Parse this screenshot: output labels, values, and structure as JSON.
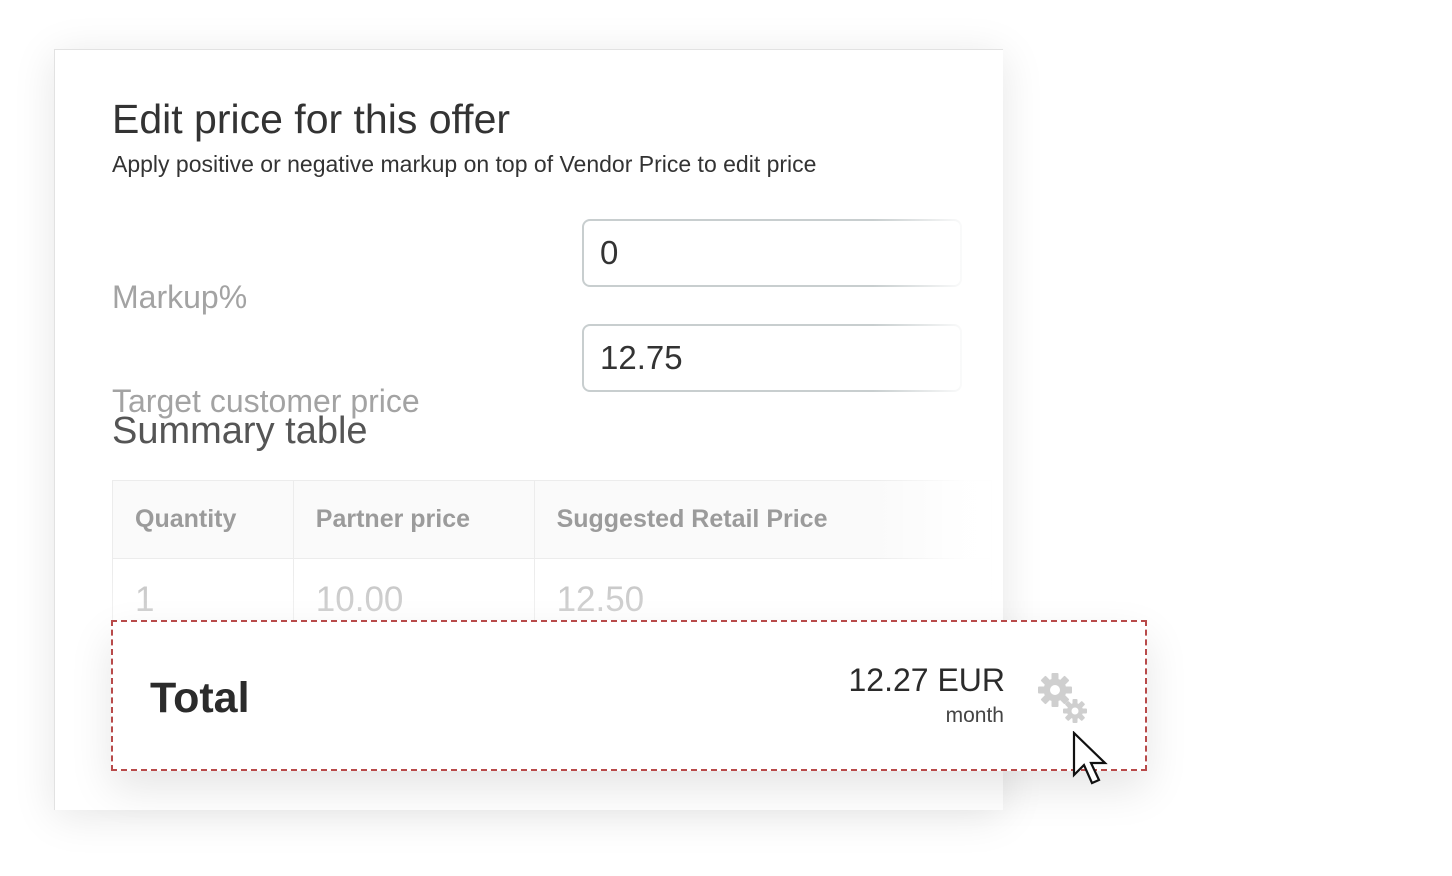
{
  "modal": {
    "title": "Edit price for this offer",
    "subtitle": "Apply positive or negative markup on top of Vendor Price to edit price"
  },
  "form": {
    "markup": {
      "label": "Markup%",
      "value": "0"
    },
    "target_price": {
      "label": "Target customer price",
      "value": "12.75"
    }
  },
  "summary": {
    "title": "Summary table",
    "columns": [
      "Quantity",
      "Partner price",
      "Suggested Retail Price"
    ],
    "rows": [
      [
        "1",
        "10.00",
        "12.50"
      ]
    ]
  },
  "total": {
    "label": "Total",
    "amount": "12.27 EUR",
    "period": "month"
  },
  "icons": {
    "settings": "gears-icon",
    "pointer": "mouse-cursor-icon"
  },
  "colors": {
    "dashed_border": "#b84a4a",
    "label_gray": "#a3a3a3",
    "text_dark": "#333333"
  }
}
